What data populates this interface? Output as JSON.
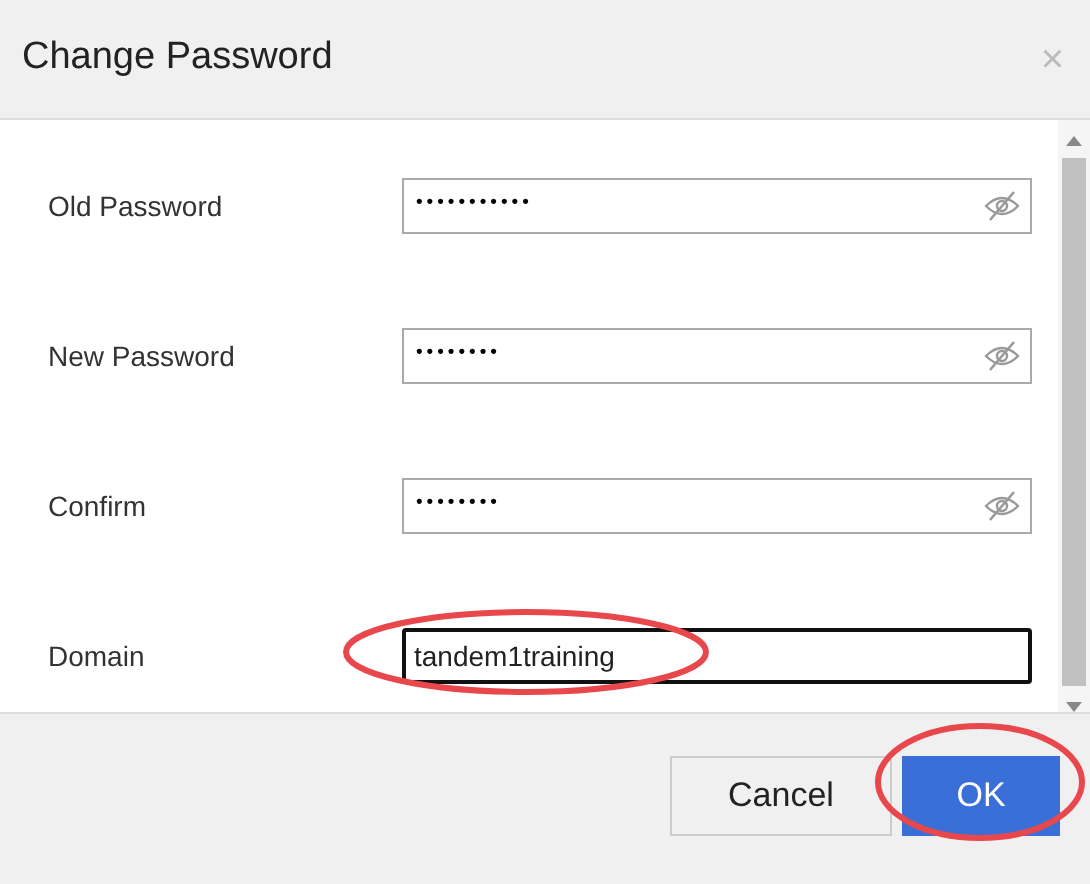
{
  "dialog": {
    "title": "Change Password",
    "close": "×"
  },
  "fields": [
    {
      "label": "Old Password",
      "kind": "password",
      "value": "•••••••••••",
      "focused": false,
      "highlighted": false
    },
    {
      "label": "New Password",
      "kind": "password",
      "value": "••••••••",
      "focused": false,
      "highlighted": false
    },
    {
      "label": "Confirm",
      "kind": "password",
      "value": "••••••••",
      "focused": false,
      "highlighted": false
    },
    {
      "label": "Domain",
      "kind": "text",
      "value": "tandem1training",
      "focused": true,
      "highlighted": true
    }
  ],
  "buttons": [
    {
      "label": "Cancel",
      "kind": "secondary",
      "highlighted": false
    },
    {
      "label": "OK",
      "kind": "primary",
      "highlighted": true
    }
  ]
}
